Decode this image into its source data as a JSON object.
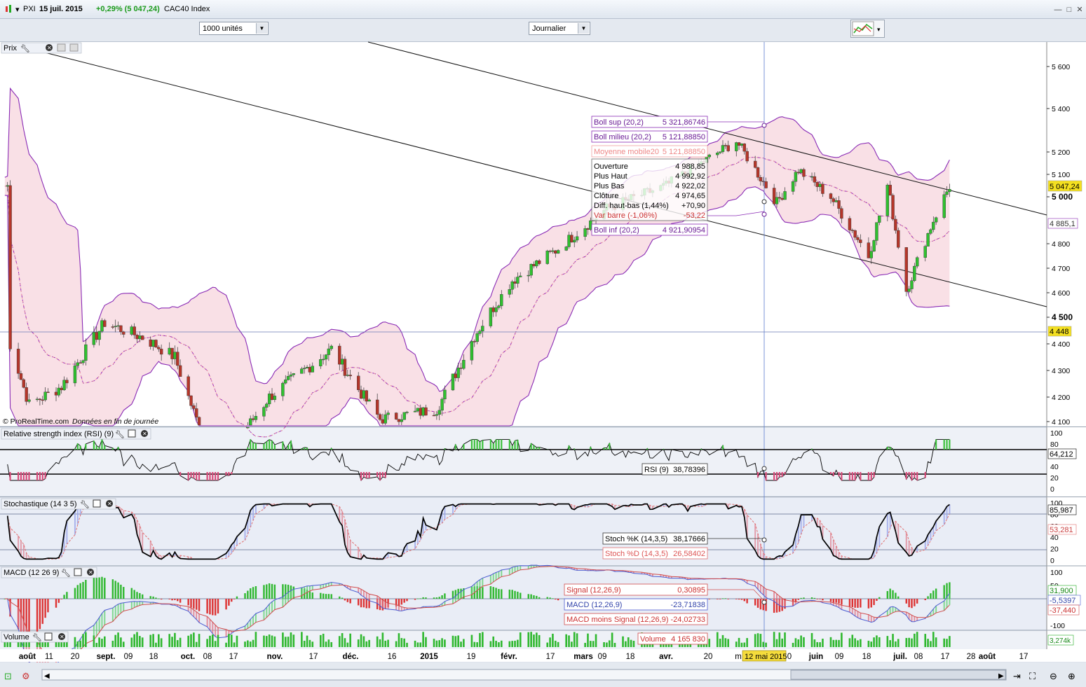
{
  "window": {
    "symbol": "PXI",
    "date": "15 juil. 2015",
    "change": "+0,29% (5 047,24)",
    "name": "CAC40 Index",
    "controls": [
      "—",
      "□",
      "✕"
    ]
  },
  "toolbar": {
    "units": "1000 unités",
    "period": "Journalier"
  },
  "price_panel": {
    "title": "Prix",
    "credit": "© ProRealTime.com",
    "credit_note": "Données en fin de journée",
    "current_price": "5 047,24",
    "side_label_1": "4 885,1",
    "hline_label": "4 448",
    "y_ticks": [
      "5 600",
      "5 400",
      "5 200",
      "5 100",
      "5 000",
      "4 800",
      "4 700",
      "4 600",
      "4 500",
      "4 400",
      "4 300",
      "4 200",
      "4 100"
    ],
    "boll_sup_label": "Boll sup (20,2)",
    "boll_sup_value": "5 321,86746",
    "boll_mid_label": "Boll milieu (20,2)",
    "boll_mid_value": "5 121,88850",
    "ma_label": "Moyenne mobile20",
    "ma_value": "5 121,88850",
    "boll_inf_label": "Boll inf (20,2)",
    "boll_inf_value": "4 921,90954",
    "ohlc": [
      {
        "label": "Ouverture",
        "value": "4 988,85"
      },
      {
        "label": "Plus Haut",
        "value": "4 992,92"
      },
      {
        "label": "Plus Bas",
        "value": "4 922,02"
      },
      {
        "label": "Clôture",
        "value": "4 974,65"
      },
      {
        "label": "Diff. haut-bas (1,44%)",
        "value": "+70,90"
      },
      {
        "label": "Var barre (-1,06%)",
        "value": "-53,22"
      }
    ]
  },
  "rsi_panel": {
    "title": "Relative strength index (RSI) (9)",
    "tag_label": "RSI (9)",
    "tag_value": "38,78396",
    "current": "64,212",
    "y_ticks": [
      "100",
      "80",
      "60",
      "40",
      "20",
      "0"
    ]
  },
  "stoch_panel": {
    "title": "Stochastique (14 3 5)",
    "k_label": "Stoch %K (14,3,5)",
    "k_value": "38,17666",
    "d_label": "Stoch %D (14,3,5)",
    "d_value": "26,58402",
    "k_current": "85,987",
    "d_current": "53,281",
    "y_ticks": [
      "100",
      "80",
      "60",
      "40",
      "20",
      "0"
    ]
  },
  "macd_panel": {
    "title": "MACD (12 26 9)",
    "signal_label": "Signal (12,26,9)",
    "signal_value": "0,30895",
    "macd_label": "MACD (12,26,9)",
    "macd_value": "-23,71838",
    "hist_label": "MACD moins Signal (12,26,9)",
    "hist_value": "-24,02733",
    "current_1": "31,900",
    "current_2": "-5,5397",
    "current_3": "-37,440",
    "y_ticks": [
      "100",
      "50",
      "0",
      "-50",
      "-100"
    ]
  },
  "volume_panel": {
    "title": "Volume",
    "tag_label": "Volume",
    "tag_value": "4 165 830",
    "current": "3,274k"
  },
  "x_axis": {
    "labels": [
      "août",
      "11",
      "20",
      "sept.",
      "09",
      "18",
      "oct.",
      "08",
      "17",
      "nov.",
      "17",
      "déc.",
      "16",
      "2015",
      "19",
      "févr.",
      "17",
      "mars",
      "09",
      "18",
      "avr.",
      "20",
      "m",
      "0",
      "juin",
      "09",
      "18",
      "juil.",
      "08",
      "17",
      "28",
      "août",
      "17"
    ],
    "cursor_date": "12 mai 2015"
  },
  "chart_data": {
    "type": "candlestick",
    "title": "PXI CAC40 Index",
    "period": "Journalier",
    "x_range": [
      "2014-07-29",
      "2015-08-20"
    ],
    "ylim": [
      4100,
      5650
    ],
    "close_series_approx": [
      {
        "x": "2014-08-01",
        "y": 4400
      },
      {
        "x": "2014-08-08",
        "y": 4170
      },
      {
        "x": "2014-08-20",
        "y": 4240
      },
      {
        "x": "2014-09-05",
        "y": 4480
      },
      {
        "x": "2014-09-20",
        "y": 4420
      },
      {
        "x": "2014-10-01",
        "y": 4350
      },
      {
        "x": "2014-10-16",
        "y": 3900
      },
      {
        "x": "2014-11-05",
        "y": 4200
      },
      {
        "x": "2014-11-28",
        "y": 4380
      },
      {
        "x": "2014-12-16",
        "y": 4110
      },
      {
        "x": "2015-01-06",
        "y": 4150
      },
      {
        "x": "2015-01-20",
        "y": 4430
      },
      {
        "x": "2015-02-03",
        "y": 4650
      },
      {
        "x": "2015-02-20",
        "y": 4780
      },
      {
        "x": "2015-03-10",
        "y": 4950
      },
      {
        "x": "2015-04-01",
        "y": 5050
      },
      {
        "x": "2015-04-27",
        "y": 5250
      },
      {
        "x": "2015-05-12",
        "y": 4975
      },
      {
        "x": "2015-05-20",
        "y": 5120
      },
      {
        "x": "2015-06-01",
        "y": 5000
      },
      {
        "x": "2015-06-15",
        "y": 4750
      },
      {
        "x": "2015-06-22",
        "y": 5050
      },
      {
        "x": "2015-06-29",
        "y": 4610
      },
      {
        "x": "2015-07-09",
        "y": 4900
      },
      {
        "x": "2015-07-15",
        "y": 5047.24
      }
    ],
    "bollinger": {
      "period": 20,
      "stddev": 2,
      "upper": 5321.87,
      "middle": 5121.89,
      "lower": 4921.91
    },
    "rsi": {
      "period": 9,
      "value_at_cursor": 38.78,
      "last": 64.21,
      "levels": [
        30,
        70
      ]
    },
    "stochastic": {
      "k": 38.18,
      "d": 26.58,
      "k_last": 85.99,
      "d_last": 53.28,
      "levels": [
        20,
        80
      ]
    },
    "macd": {
      "signal": 0.31,
      "macd": -23.72,
      "histogram": -24.03
    },
    "volume_at_cursor": 4165830,
    "hline": 4448,
    "cursor": "2015-05-12"
  }
}
